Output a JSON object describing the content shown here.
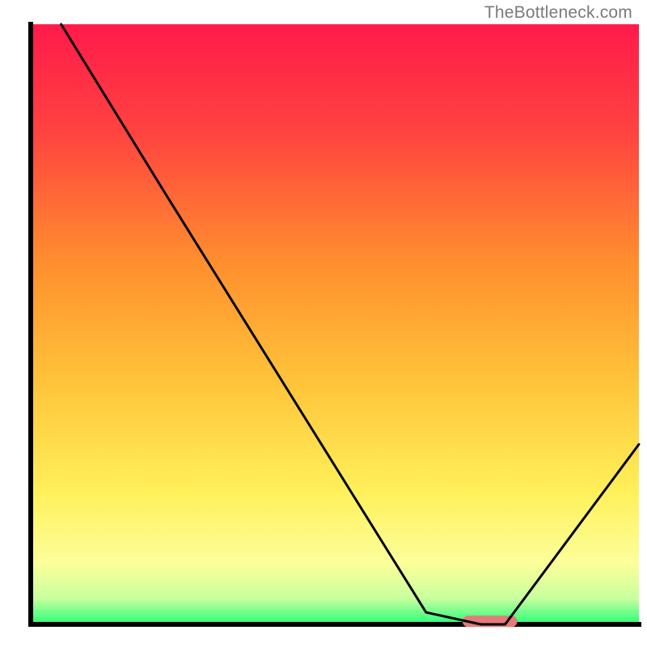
{
  "watermark": "TheBottleneck.com",
  "chart_data": {
    "type": "line",
    "title": "",
    "xlabel": "",
    "ylabel": "",
    "xlim": [
      0,
      100
    ],
    "ylim": [
      0,
      100
    ],
    "grid": false,
    "series": [
      {
        "name": "bottleneck-curve",
        "x": [
          5,
          22,
          65,
          74,
          78,
          100
        ],
        "y": [
          100,
          72,
          2,
          0,
          0,
          30
        ],
        "color": "#000000"
      }
    ],
    "marker": {
      "name": "optimal-range",
      "x_start": 71,
      "x_end": 80,
      "y": 0.5,
      "color": "#e47a7a"
    },
    "background_gradient": {
      "stops": [
        {
          "offset": 0.0,
          "color": "#ff1a4b"
        },
        {
          "offset": 0.18,
          "color": "#ff4340"
        },
        {
          "offset": 0.4,
          "color": "#ff8f2e"
        },
        {
          "offset": 0.6,
          "color": "#ffc43a"
        },
        {
          "offset": 0.78,
          "color": "#fff05a"
        },
        {
          "offset": 0.9,
          "color": "#fcff9a"
        },
        {
          "offset": 0.96,
          "color": "#c8ff9e"
        },
        {
          "offset": 1.0,
          "color": "#2fff7a"
        }
      ]
    },
    "axes_color": "#000000"
  }
}
